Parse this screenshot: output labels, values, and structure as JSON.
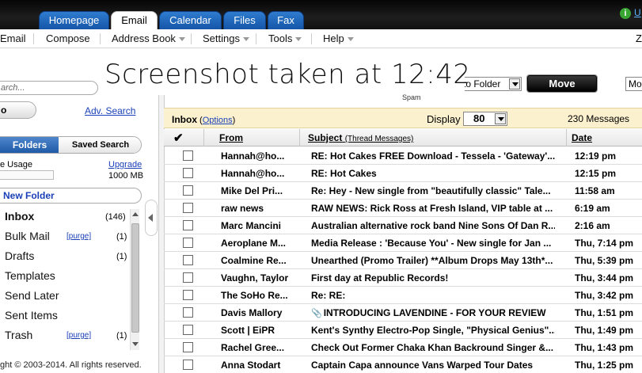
{
  "tabs": [
    "Homepage",
    "Email",
    "Calendar",
    "Files",
    "Fax"
  ],
  "status": {
    "icon": "info-icon",
    "link": "U"
  },
  "menu": [
    "Email",
    "Compose",
    "Address Book",
    "Settings",
    "Tools",
    "Help"
  ],
  "menu_right": "Z",
  "caption": "Screenshot taken at 12:42",
  "toolbar": {
    "spam_label": "Spam",
    "folder_select": "to Folder",
    "move_button": "Move",
    "more_select": "Mo"
  },
  "sidebar": {
    "search_placeholder": "arch...",
    "search_button": "o",
    "adv_search": "Adv. Search",
    "tab_folders": "Folders",
    "tab_saved": "Saved Search",
    "usage_label": "e Usage",
    "upgrade": "Upgrade",
    "usage_total": "1000 MB",
    "usage_fraction": 0.0,
    "new_folder": "New Folder",
    "folders": [
      {
        "name": "Inbox",
        "count": "(146)",
        "purge": ""
      },
      {
        "name": "Bulk Mail",
        "count": "(1)",
        "purge": "[purge]"
      },
      {
        "name": "Drafts",
        "count": "(1)",
        "purge": ""
      },
      {
        "name": "Templates",
        "count": "",
        "purge": ""
      },
      {
        "name": "Send Later",
        "count": "",
        "purge": ""
      },
      {
        "name": "Sent Items",
        "count": "",
        "purge": ""
      },
      {
        "name": "Trash",
        "count": "(1)",
        "purge": "[purge]"
      }
    ],
    "copyright": "ght © 2003-2014. All rights reserved."
  },
  "list": {
    "inbox_label": "Inbox",
    "options_link": "Options",
    "display_label": "Display",
    "display_value": "80",
    "message_count": "230 Messages",
    "col_from": "From",
    "col_subject": "Subject",
    "col_thread": "(Thread Messages)",
    "col_date": "Date",
    "rows": [
      {
        "from": "Hannah@ho...",
        "subject": "RE: Hot Cakes FREE Download - Tessela - 'Gateway'...",
        "date": "12:19 pm",
        "attachment": false
      },
      {
        "from": "Hannah@ho...",
        "subject": "RE: Hot Cakes",
        "date": "12:15 pm",
        "attachment": false
      },
      {
        "from": "Mike Del Pri...",
        "subject": "Re: Hey - New single from \"beautifully classic\" Tale...",
        "date": "11:58 am",
        "attachment": false
      },
      {
        "from": "raw news",
        "subject": "RAW NEWS: Rick Ross at Fresh Island, VIP table at ...",
        "date": "6:19 am",
        "attachment": false
      },
      {
        "from": "Marc Mancini",
        "subject": "Australian alternative rock band Nine Sons Of Dan R...",
        "date": "2:16 am",
        "attachment": false
      },
      {
        "from": "Aeroplane M...",
        "subject": "Media Release : 'Because You' - New single for Jan ...",
        "date": "Thu, 7:14 pm",
        "attachment": false
      },
      {
        "from": "Coalmine Re...",
        "subject": "Unearthed (Promo Trailer) **Album Drops May 13th*...",
        "date": "Thu, 5:39 pm",
        "attachment": false
      },
      {
        "from": "Vaughn, Taylor",
        "subject": "First day at Republic Records!",
        "date": "Thu, 3:44 pm",
        "attachment": false
      },
      {
        "from": "The SoHo Re...",
        "subject": "Re: RE:",
        "date": "Thu, 3:42 pm",
        "attachment": false
      },
      {
        "from": "Davis Mallory",
        "subject": "INTRODUCING LAVENDINE - FOR YOUR REVIEW",
        "date": "Thu, 1:51 pm",
        "attachment": true
      },
      {
        "from": "Scott | EiPR",
        "subject": "Kent's Synthy Electro-Pop Single, \"Physical Genius\"...",
        "date": "Thu, 1:49 pm",
        "attachment": false
      },
      {
        "from": "Rachel Gree...",
        "subject": "Check Out Former Chaka Khan Backround Singer &...",
        "date": "Thu, 1:43 pm",
        "attachment": false
      },
      {
        "from": "Anna Stodart",
        "subject": "Captain Capa announce Vans Warped Tour Dates",
        "date": "Thu, 1:25 pm",
        "attachment": false
      }
    ]
  }
}
